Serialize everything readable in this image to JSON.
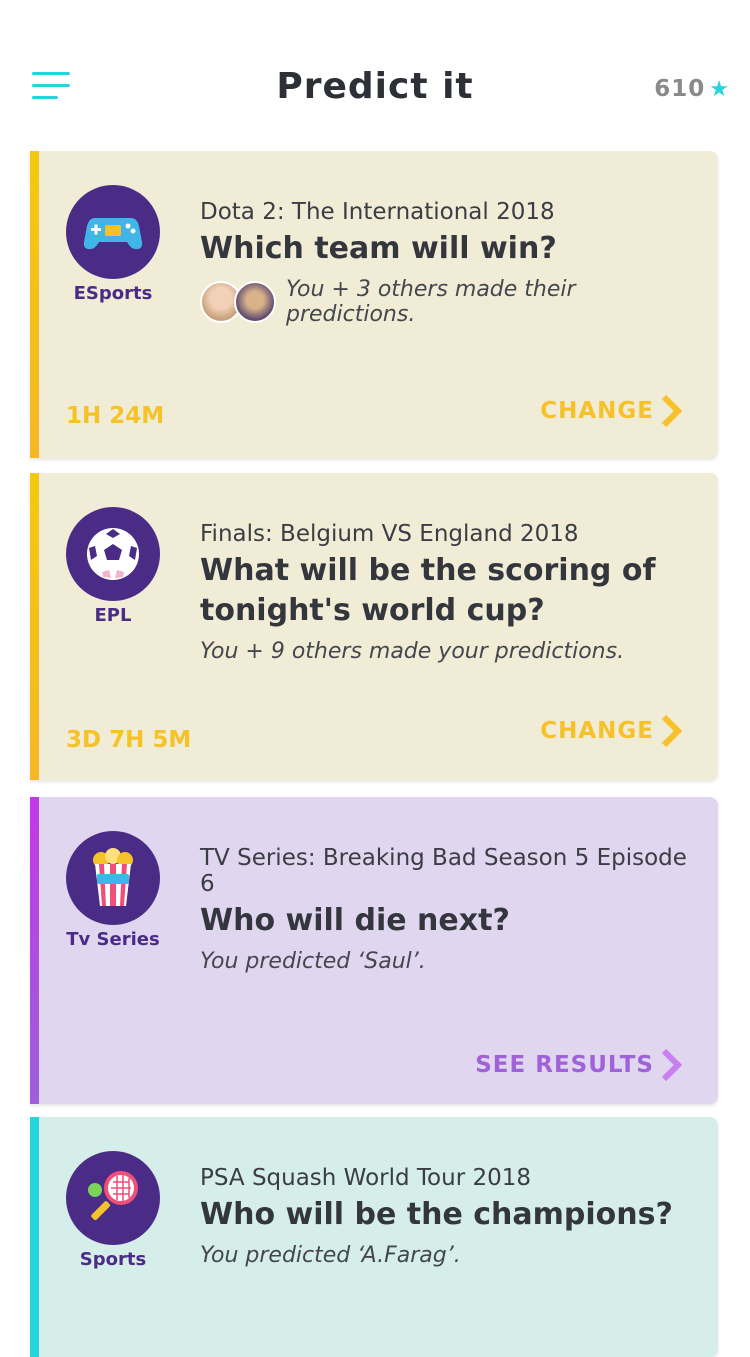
{
  "header": {
    "title": "Predict it",
    "points": "610",
    "star_icon": "star-icon",
    "menu_icon": "menu-icon"
  },
  "colors": {
    "teal": "#27d4dc",
    "yellow": "#f6c229",
    "purple": "#4a2b86",
    "esports_bg": "#f0ecd6",
    "tv_bg": "#e1d6f0",
    "sports_bg": "#d5eeea"
  },
  "cards": [
    {
      "category": "ESports",
      "icon": "gamepad-icon",
      "event": "Dota 2: The International 2018",
      "question": "Which team will win?",
      "status": "You + 3 others made their predictions.",
      "timer": "1H 24M",
      "action": "CHANGE"
    },
    {
      "category": "EPL",
      "icon": "soccer-ball-icon",
      "event": "Finals: Belgium VS England 2018",
      "question": "What will be the scoring of tonight's world cup?",
      "status": "You + 9 others made your predictions.",
      "timer": "3D 7H 5M",
      "action": "CHANGE"
    },
    {
      "category": "Tv Series",
      "icon": "popcorn-icon",
      "event": "TV Series: Breaking Bad Season 5 Episode 6",
      "question": "Who will die next?",
      "status": "You predicted ‘Saul’.",
      "action": "SEE RESULTS"
    },
    {
      "category": "Sports",
      "icon": "tennis-racket-icon",
      "event": "PSA Squash World Tour 2018",
      "question": "Who will be the champions?",
      "status": "You predicted ‘A.Farag’."
    }
  ]
}
